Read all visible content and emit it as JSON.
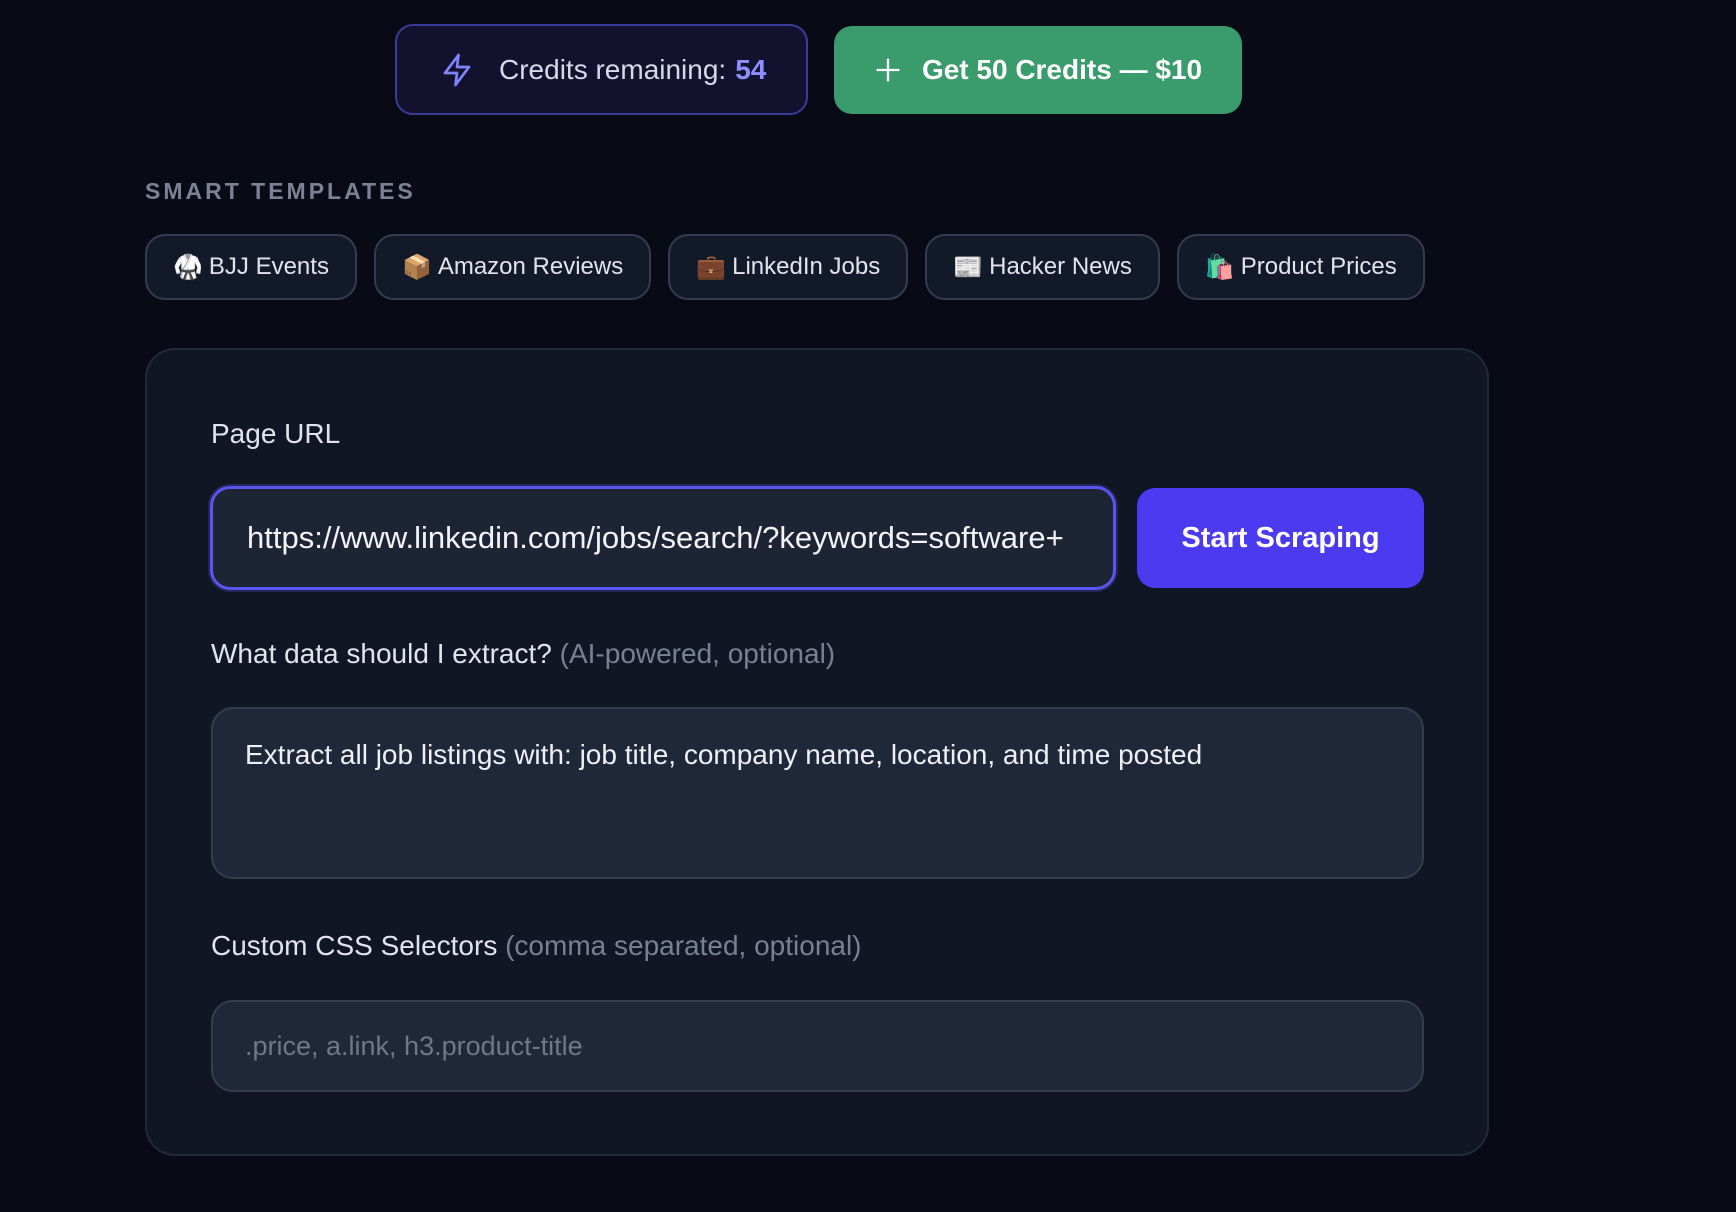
{
  "credits": {
    "label": "Credits remaining:",
    "count": "54",
    "icon": "lightning-bolt-icon",
    "accent_color": "#8b8fff"
  },
  "buy": {
    "label": "Get 50 Credits — $10",
    "icon": "plus-icon",
    "color": "#3a9c6c"
  },
  "templates": {
    "heading": "SMART TEMPLATES",
    "items": [
      {
        "emoji": "🥋",
        "label": "BJJ Events"
      },
      {
        "emoji": "📦",
        "label": "Amazon Reviews"
      },
      {
        "emoji": "💼",
        "label": "LinkedIn Jobs"
      },
      {
        "emoji": "📰",
        "label": "Hacker News"
      },
      {
        "emoji": "🛍️",
        "label": "Product Prices"
      }
    ]
  },
  "form": {
    "url_label": "Page URL",
    "url_value": "https://www.linkedin.com/jobs/search/?keywords=software+",
    "start_label": "Start Scraping",
    "start_color": "#4b3aef",
    "prompt_label": "What data should I extract?",
    "prompt_hint": "(AI-powered, optional)",
    "prompt_value": "Extract all job listings with: job title, company name, location, and time posted",
    "selectors_label": "Custom CSS Selectors",
    "selectors_hint": "(comma separated, optional)",
    "selectors_value": "",
    "selectors_placeholder": ".price, a.link, h3.product-title"
  }
}
